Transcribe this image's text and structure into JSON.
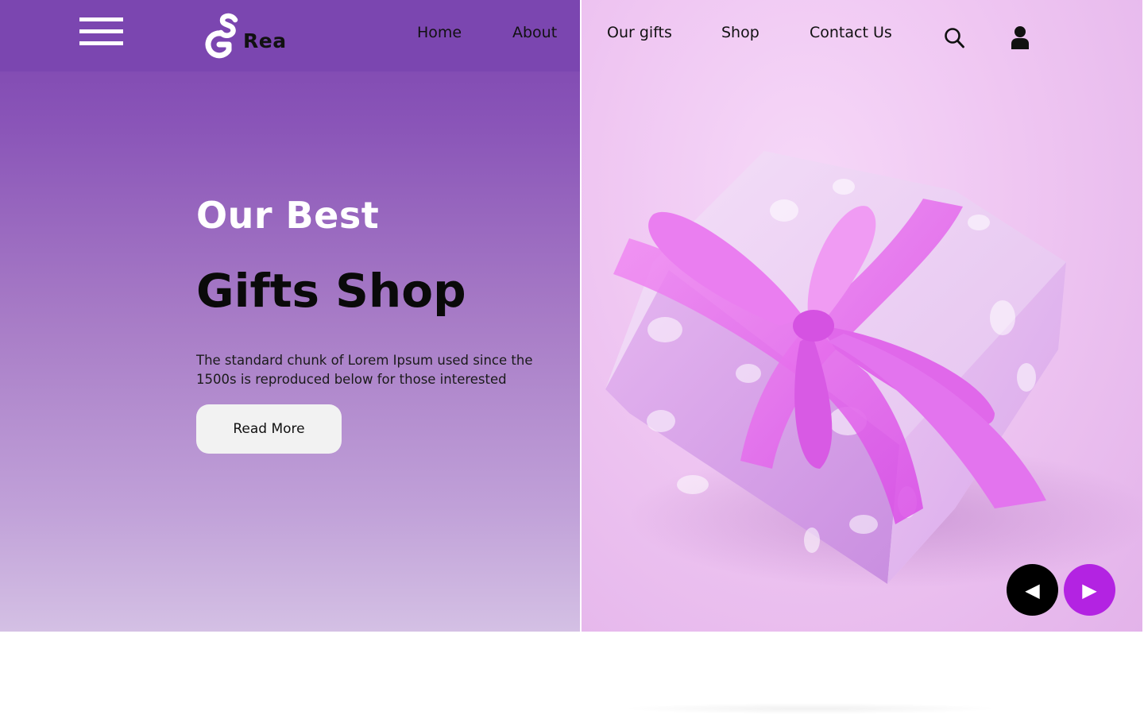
{
  "brand": {
    "name": "Rea",
    "logo_letters": "GS"
  },
  "nav": {
    "items": [
      {
        "label": "Home"
      },
      {
        "label": "About"
      },
      {
        "label": "Our gifts"
      },
      {
        "label": "Shop"
      },
      {
        "label": "Contact Us"
      }
    ],
    "icons": [
      "menu-icon",
      "search-icon",
      "user-icon"
    ]
  },
  "hero": {
    "title_line1": "Our Best",
    "title_line2": "Gifts Shop",
    "description": "The standard chunk of Lorem Ipsum used since the 1500s is reproduced below for those interested",
    "button_label": "Read More",
    "image_subject": "pink gift box with ribbon bow"
  },
  "slider": {
    "prev_icon": "arrow-left-icon",
    "next_icon": "arrow-right-icon",
    "prev_glyph": "◀",
    "next_glyph": "▶"
  },
  "colors": {
    "purple": "#7b46b0",
    "accent": "#b323e2",
    "pink_bg": "#efc6f2",
    "button_bg": "#f2f2f2"
  }
}
